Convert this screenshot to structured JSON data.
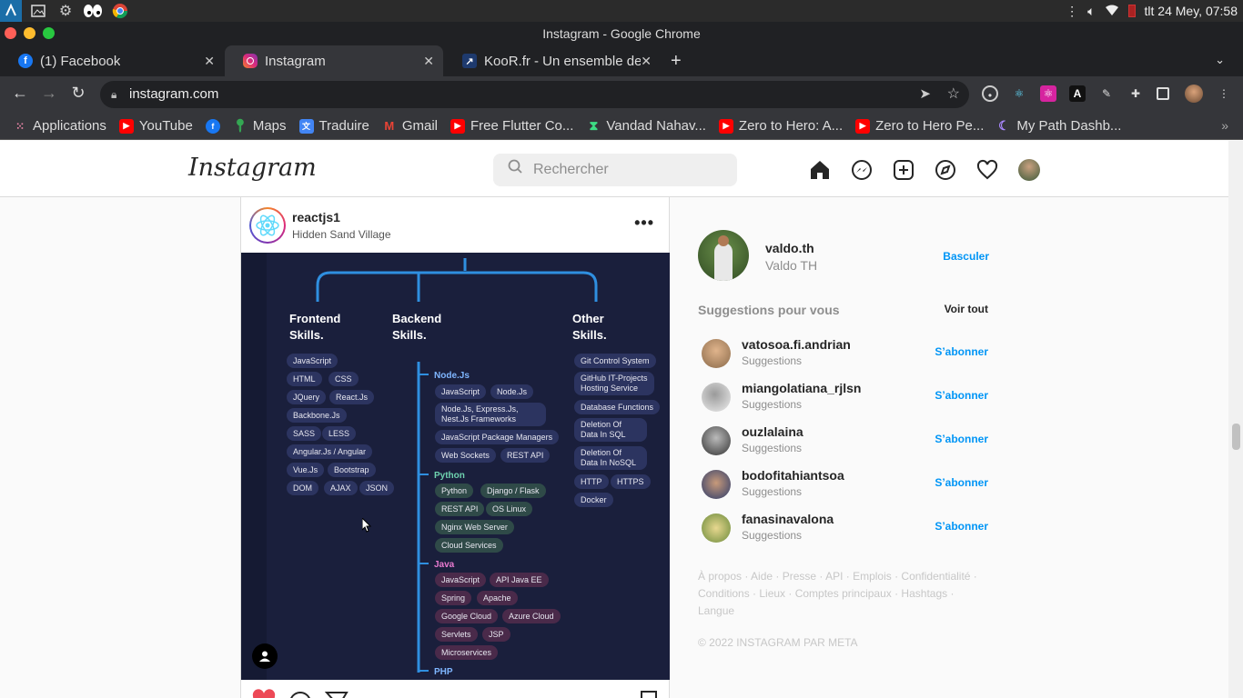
{
  "system": {
    "datetime": "tlt 24 Mey, 07:58"
  },
  "window": {
    "title": "Instagram - Google Chrome"
  },
  "tabs": [
    {
      "label": "(1) Facebook",
      "active": false
    },
    {
      "label": "Instagram",
      "active": true
    },
    {
      "label": "KooR.fr - Un ensemble de",
      "active": false
    }
  ],
  "address": {
    "url": "instagram.com"
  },
  "bookmarks": [
    {
      "label": "Applications"
    },
    {
      "label": "YouTube"
    },
    {
      "label": ""
    },
    {
      "label": "Maps"
    },
    {
      "label": "Traduire"
    },
    {
      "label": "Gmail"
    },
    {
      "label": "Free Flutter Co..."
    },
    {
      "label": "Vandad Nahav..."
    },
    {
      "label": "Zero to Hero: A..."
    },
    {
      "label": "Zero to Hero Pe..."
    },
    {
      "label": "My Path Dashb..."
    }
  ],
  "ig": {
    "logo": "Instagram",
    "search_placeholder": "Rechercher"
  },
  "post": {
    "username": "reactjs1",
    "location": "Hidden Sand Village",
    "image": {
      "frontend_title": "Frontend Skills.",
      "backend_title": "Backend Skills.",
      "other_title": "Other Skills.",
      "frontend": [
        "JavaScript",
        "HTML",
        "CSS",
        "JQuery",
        "React.Js",
        "Backbone.Js",
        "SASS",
        "LESS",
        "Angular.Js / Angular",
        "Vue.Js",
        "Bootstrap",
        "DOM",
        "AJAX",
        "JSON"
      ],
      "node_title": "Node.Js",
      "node": [
        "JavaScript",
        "Node.Js",
        "Node.Js, Express.Js, Nest.Js Frameworks",
        "JavaScript Package Managers",
        "Web Sockets",
        "REST API"
      ],
      "python_title": "Python",
      "python": [
        "Python",
        "Django / Flask",
        "REST API",
        "OS Linux",
        "Nginx Web Server",
        "Cloud Services"
      ],
      "java_title": "Java",
      "java": [
        "JavaScript",
        "API Java EE",
        "Spring",
        "Apache",
        "Google Cloud",
        "Azure Cloud",
        "Servlets",
        "JSP",
        "Microservices"
      ],
      "php_title": "PHP",
      "other": [
        "Git Control System",
        "GitHub IT-Projects Hosting Service",
        "Database Functions",
        "Deletion Of Data In SQL",
        "Deletion Of Data In NoSQL",
        "HTTP",
        "HTTPS",
        "Docker"
      ]
    }
  },
  "rail": {
    "me": {
      "username": "valdo.th",
      "name": "Valdo TH",
      "switch": "Basculer"
    },
    "suggestions_title": "Suggestions pour vous",
    "see_all": "Voir tout",
    "suggestions": [
      {
        "username": "vatosoa.fi.andrian",
        "sub": "Suggestions",
        "follow": "S’abonner"
      },
      {
        "username": "miangolatiana_rjlsn",
        "sub": "Suggestions",
        "follow": "S’abonner"
      },
      {
        "username": "ouzlalaina",
        "sub": "Suggestions",
        "follow": "S’abonner"
      },
      {
        "username": "bodofitahiantsoa",
        "sub": "Suggestions",
        "follow": "S’abonner"
      },
      {
        "username": "fanasinavalona",
        "sub": "Suggestions",
        "follow": "S’abonner"
      }
    ],
    "footer_links": "À propos · Aide · Presse · API · Emplois · Confidentialité · Conditions · Lieux · Comptes principaux · Hashtags · Langue",
    "copyright": "© 2022 INSTAGRAM PAR META"
  },
  "colors": {
    "accent": "#0095f6",
    "chrome_dark": "#35363a",
    "ig_border": "#dbdbdb",
    "like": "#ed4956"
  }
}
